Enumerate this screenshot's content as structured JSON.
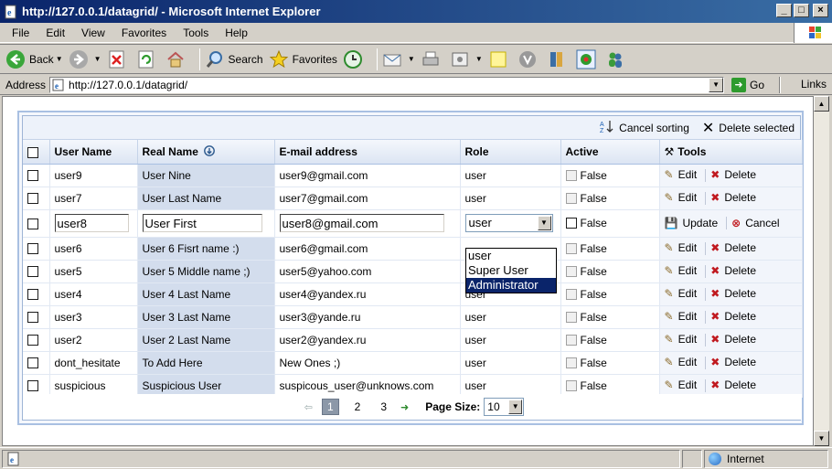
{
  "window": {
    "title": "http://127.0.0.1/datagrid/ - Microsoft Internet Explorer"
  },
  "menu": [
    "File",
    "Edit",
    "View",
    "Favorites",
    "Tools",
    "Help"
  ],
  "toolbar": {
    "back": "Back",
    "search": "Search",
    "favorites": "Favorites"
  },
  "address": {
    "label": "Address",
    "url": "http://127.0.0.1/datagrid/",
    "go": "Go",
    "links": "Links"
  },
  "grid": {
    "commands": {
      "cancel_sorting": "Cancel sorting",
      "delete_selected": "Delete selected"
    },
    "columns": {
      "username": "User Name",
      "realname": "Real Name",
      "email": "E-mail address",
      "role": "Role",
      "active": "Active",
      "tools": "Tools"
    },
    "rows": [
      {
        "username": "user9",
        "realname": "User Nine",
        "email": "user9@gmail.com",
        "role": "user",
        "active": "False"
      },
      {
        "username": "user7",
        "realname": "User Last Name",
        "email": "user7@gmail.com",
        "role": "user",
        "active": "False"
      },
      {
        "username": "user8",
        "realname": "User First",
        "email": "user8@gmail.com",
        "role": "user",
        "active": "False",
        "editing": true
      },
      {
        "username": "user6",
        "realname": "User 6 Fisrt name :)",
        "email": "user6@gmail.com",
        "role": "",
        "active": "False"
      },
      {
        "username": "user5",
        "realname": "User 5 Middle name ;)",
        "email": "user5@yahoo.com",
        "role": "",
        "active": "False"
      },
      {
        "username": "user4",
        "realname": "User 4 Last Name",
        "email": "user4@yandex.ru",
        "role": "user",
        "active": "False"
      },
      {
        "username": "user3",
        "realname": "User 3 Last Name",
        "email": "user3@yande.ru",
        "role": "user",
        "active": "False"
      },
      {
        "username": "user2",
        "realname": "User 2 Last Name",
        "email": "user2@yandex.ru",
        "role": "user",
        "active": "False"
      },
      {
        "username": "dont_hesitate",
        "realname": "To Add Here",
        "email": "New Ones ;)",
        "role": "user",
        "active": "False"
      },
      {
        "username": "suspicious",
        "realname": "Suspicious User",
        "email": "suspicous_user@unknows.com",
        "role": "user",
        "active": "False"
      }
    ],
    "actions": {
      "edit": "Edit",
      "delete": "Delete",
      "update": "Update",
      "cancel": "Cancel"
    },
    "role_options": [
      "user",
      "Super User",
      "Administrator"
    ],
    "role_selected_option": "Administrator",
    "pager": {
      "pages": [
        "1",
        "2",
        "3"
      ],
      "current": "1",
      "page_size_label": "Page Size:",
      "page_size": "10"
    }
  },
  "status": {
    "zone": "Internet"
  }
}
